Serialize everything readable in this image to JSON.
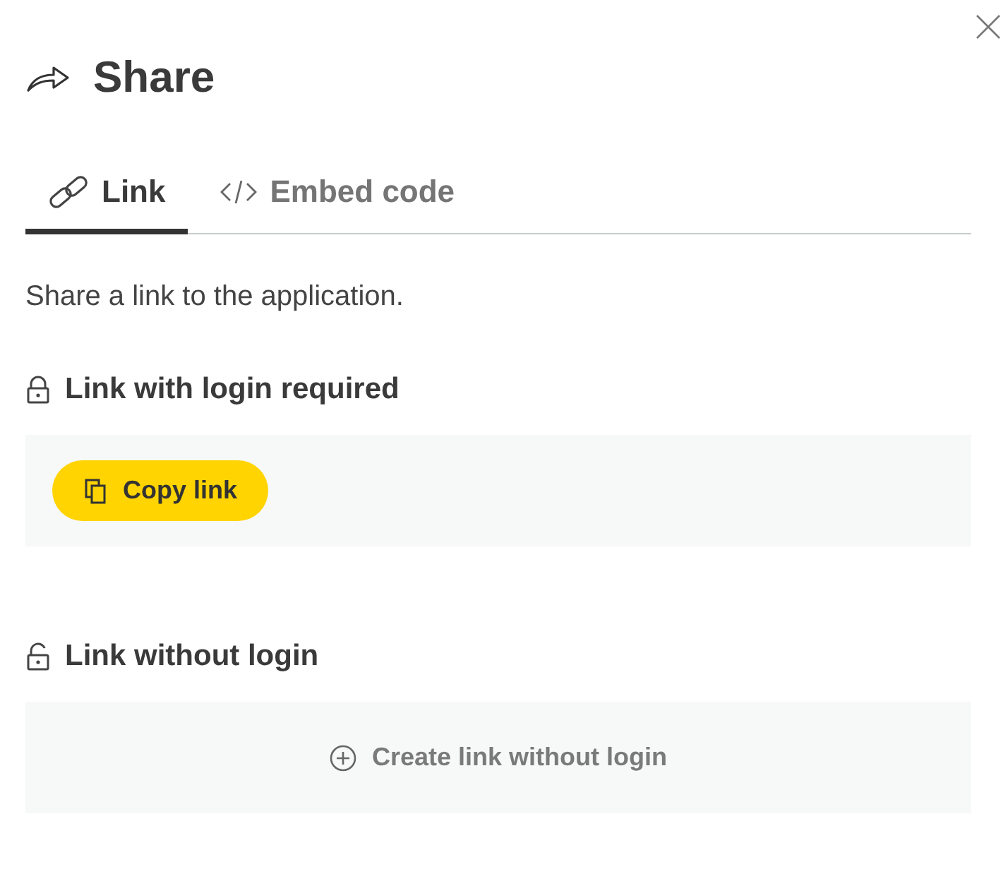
{
  "dialog": {
    "title": "Share"
  },
  "tabs": [
    {
      "label": "Link",
      "kind": "link",
      "selected": true
    },
    {
      "label": "Embed code",
      "kind": "code",
      "selected": false
    }
  ],
  "description": "Share a link to the application.",
  "sections": [
    {
      "heading": "Link with login required",
      "locked": true,
      "action": {
        "kind": "copy",
        "label": "Copy link"
      }
    },
    {
      "heading": "Link without login",
      "locked": false,
      "action": {
        "kind": "create",
        "label": "Create link without login"
      }
    }
  ]
}
